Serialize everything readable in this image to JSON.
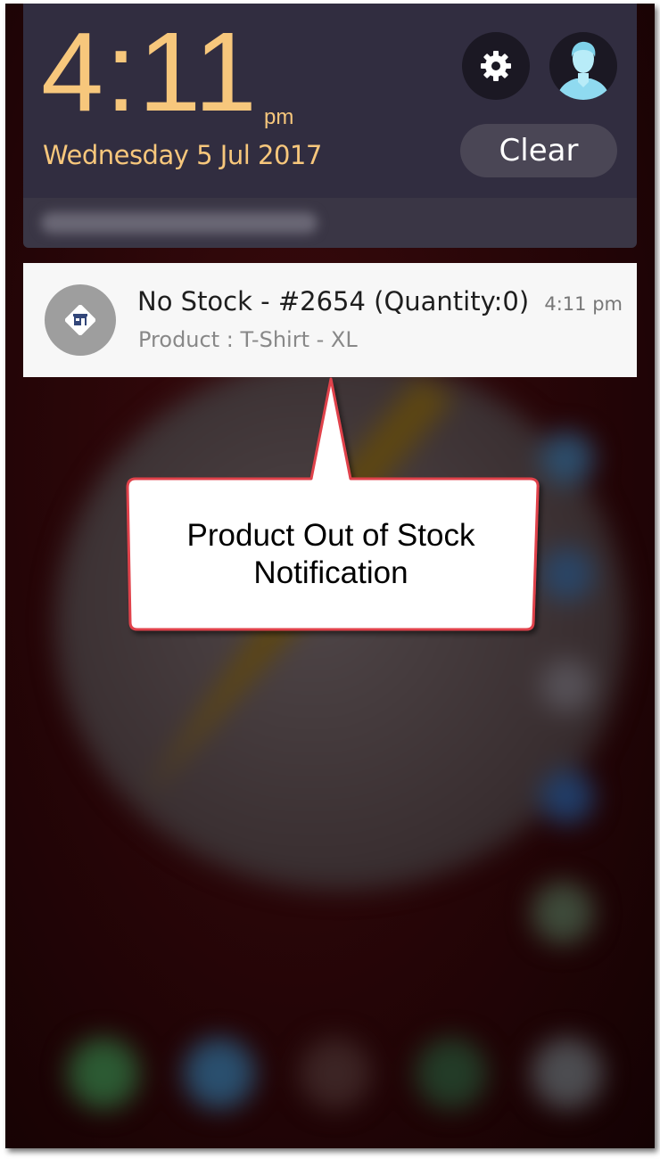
{
  "header": {
    "time": "4:11",
    "ampm": "pm",
    "date": "Wednesday 5 Jul 2017",
    "clear_label": "Clear"
  },
  "icons": {
    "settings": "gear-icon",
    "avatar": "user-avatar-icon",
    "app": "store-icon"
  },
  "notification": {
    "title": "No Stock - #2654 (Quantity:0)",
    "text": "Product : T-Shirt - XL",
    "time": "4:11 pm"
  },
  "callout": {
    "line1": "Product Out of Stock",
    "line2": "Notification"
  },
  "colors": {
    "clock_accent": "#f7c77c",
    "shade_background": "#312d40",
    "callout_border": "#e0434b"
  }
}
